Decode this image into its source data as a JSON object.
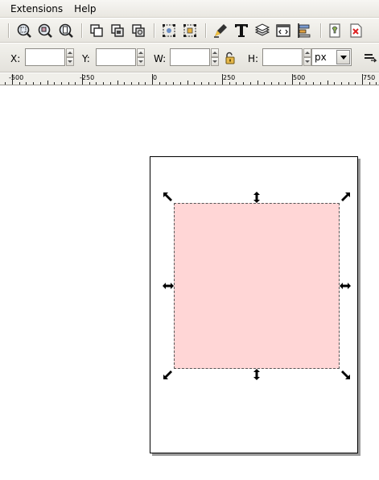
{
  "menu": {
    "items": [
      "Extensions",
      "Help"
    ]
  },
  "toolbar": {
    "buttons": [
      {
        "name": "zoom-selection-icon"
      },
      {
        "name": "zoom-drawing-icon"
      },
      {
        "name": "zoom-page-icon"
      },
      {
        "name": "duplicate-icon"
      },
      {
        "name": "clone-icon"
      },
      {
        "name": "unlink-clone-icon"
      },
      {
        "name": "group-icon"
      },
      {
        "name": "ungroup-icon"
      },
      {
        "name": "fill-stroke-icon"
      },
      {
        "name": "text-font-icon"
      },
      {
        "name": "layers-icon"
      },
      {
        "name": "xml-editor-icon"
      },
      {
        "name": "align-distribute-icon"
      },
      {
        "name": "preferences-icon"
      },
      {
        "name": "document-properties-icon"
      }
    ]
  },
  "controls": {
    "x_label": "X:",
    "y_label": "Y:",
    "w_label": "W:",
    "h_label": "H:",
    "x_value": "",
    "y_value": "",
    "w_value": "",
    "h_value": "",
    "unit": "px",
    "lock_icon": "lock-open-icon"
  },
  "ruler": {
    "labels": [
      "-500",
      "-250",
      "0",
      "250",
      "500",
      "750"
    ]
  },
  "colors": {
    "rect_fill": "#ffd6d6",
    "selection_dash": "#555555"
  }
}
